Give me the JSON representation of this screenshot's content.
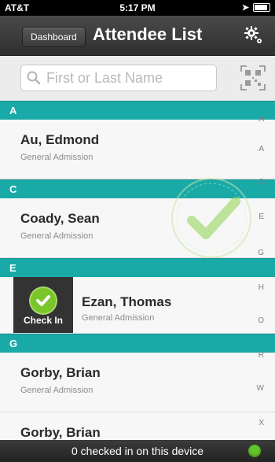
{
  "status_bar": {
    "carrier": "AT&T",
    "time": "5:17 PM"
  },
  "nav": {
    "back_label": "Dashboard",
    "title": "Attendee List"
  },
  "search": {
    "placeholder": "First or Last Name",
    "value": ""
  },
  "sections": [
    {
      "letter": "A"
    },
    {
      "letter": "C"
    },
    {
      "letter": "E"
    },
    {
      "letter": "G"
    }
  ],
  "attendees": [
    {
      "name": "Au, Edmond",
      "type": "General Admission"
    },
    {
      "name": "Coady, Sean",
      "type": "General Admission"
    },
    {
      "name": "Ezan, Thomas",
      "type": "General Admission"
    },
    {
      "name": "Gorby, Brian",
      "type": "General Admission"
    },
    {
      "name": "Gorby, Brian",
      "type": ""
    }
  ],
  "check_in": {
    "label": "Check In"
  },
  "index_letters": [
    "A",
    "C",
    "E",
    "G",
    "H",
    "O",
    "R",
    "W",
    "X"
  ],
  "footer": {
    "status_text": "0 checked in on this device",
    "status_color": "#64c42b"
  },
  "colors": {
    "section_header": "#19aaa8",
    "check_green": "#79c52a"
  }
}
